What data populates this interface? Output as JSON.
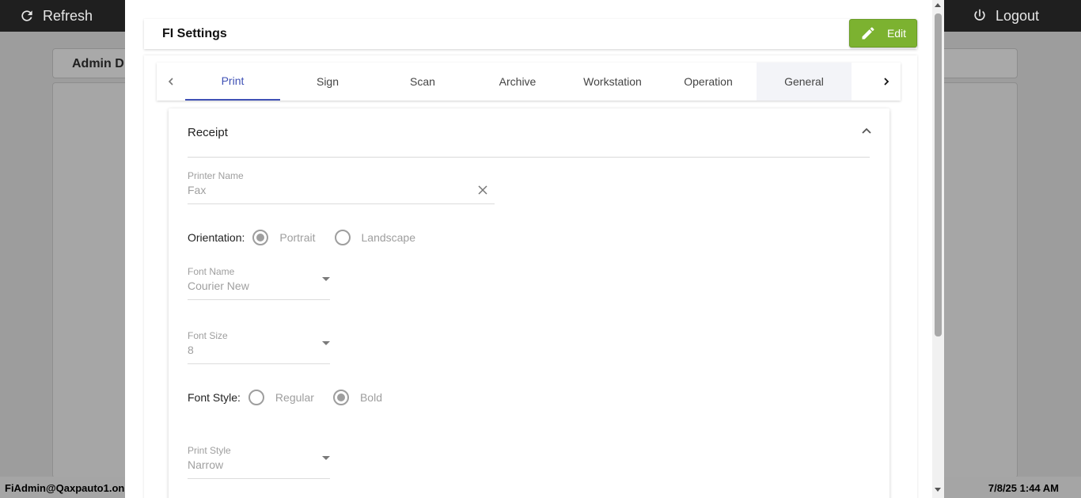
{
  "app": {
    "refresh_label": "Refresh",
    "logout_label": "Logout",
    "admin_title": "Admin D",
    "status_user": "FiAdmin@Qaxpauto1.onr",
    "status_time": "7/8/25 1:44 AM"
  },
  "dialog": {
    "title": "FI Settings",
    "edit_label": "Edit",
    "accent_color": "#7cb230"
  },
  "tabs": {
    "items": [
      "Print",
      "Sign",
      "Scan",
      "Archive",
      "Workstation",
      "Operation",
      "General"
    ],
    "active": "Print",
    "active_color": "#3f51b5"
  },
  "receipt": {
    "title": "Receipt",
    "printer_name": {
      "label": "Printer Name",
      "value": "Fax"
    },
    "orientation": {
      "label": "Orientation:",
      "options": [
        "Portrait",
        "Landscape"
      ],
      "selected": "Portrait"
    },
    "font_name": {
      "label": "Font Name",
      "value": "Courier New"
    },
    "font_size": {
      "label": "Font Size",
      "value": "8"
    },
    "font_style": {
      "label": "Font Style:",
      "options": [
        "Regular",
        "Bold"
      ],
      "selected": "Bold"
    },
    "print_style": {
      "label": "Print Style",
      "value": "Narrow"
    }
  },
  "icons": {
    "refresh": "refresh-icon",
    "logout": "power-icon",
    "edit": "pencil-icon",
    "clear": "close-icon",
    "collapse": "chevron-up-icon"
  }
}
